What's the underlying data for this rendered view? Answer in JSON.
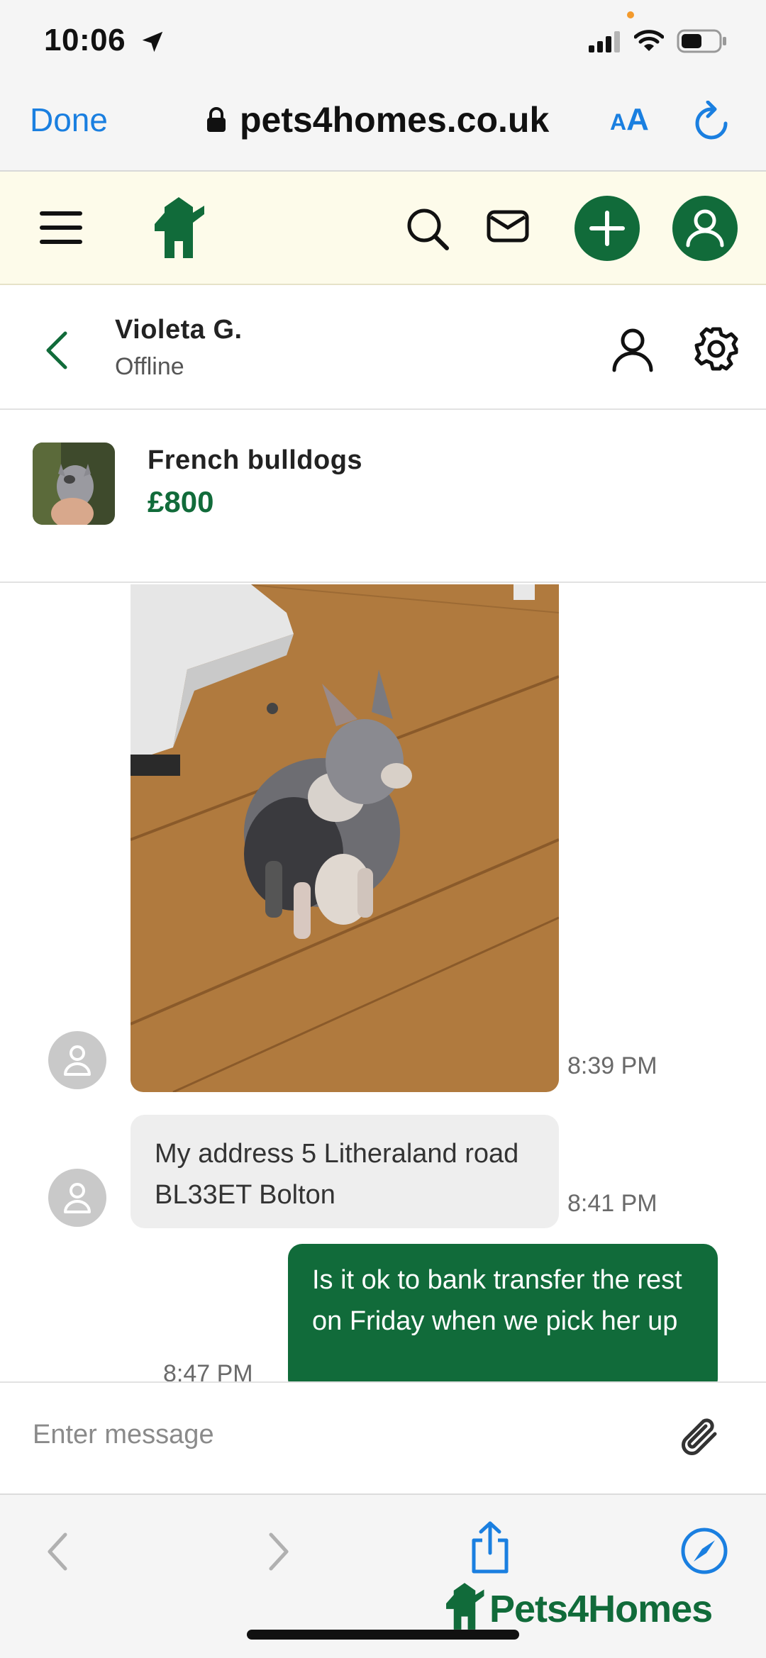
{
  "status_bar": {
    "time": "10:06"
  },
  "browser": {
    "done_label": "Done",
    "url": "pets4homes.co.uk",
    "text_size_label_small": "A",
    "text_size_label_large": "A"
  },
  "chat": {
    "contact_name": "Violeta G.",
    "contact_status": "Offline"
  },
  "listing": {
    "title": "French bulldogs",
    "price": "£800"
  },
  "messages": [
    {
      "type": "image",
      "direction": "incoming",
      "time": "8:39 PM"
    },
    {
      "type": "text",
      "direction": "incoming",
      "text": "My address 5 Litheraland road BL33ET Bolton",
      "time": "8:41 PM"
    },
    {
      "type": "text",
      "direction": "outgoing",
      "text": "Is it ok to bank transfer the rest on Friday when we pick her up",
      "time": "8:47 PM"
    }
  ],
  "composer": {
    "placeholder": "Enter message"
  },
  "brand": {
    "name": "Pets4Homes"
  },
  "colors": {
    "brand_green": "#116b3a",
    "ios_blue": "#1a7fe0",
    "header_cream": "#fdfbea"
  }
}
